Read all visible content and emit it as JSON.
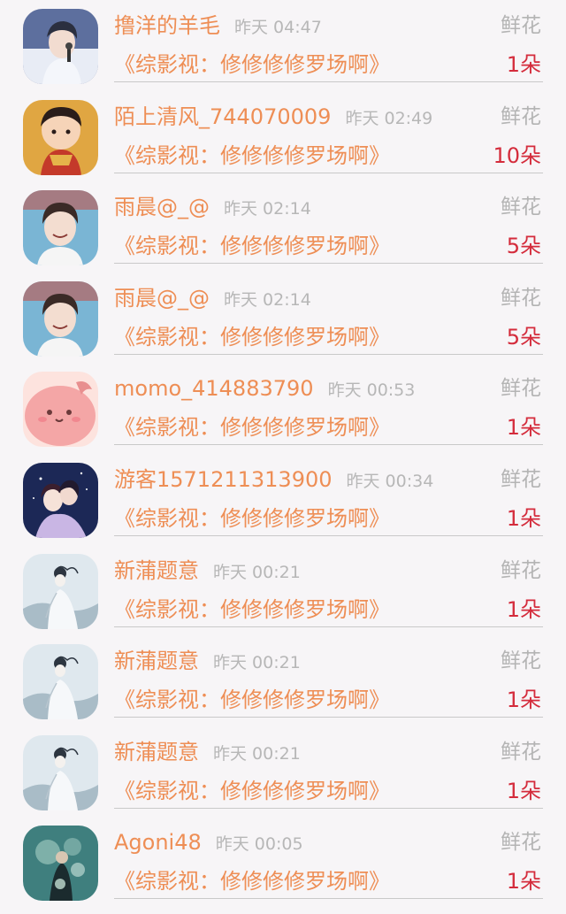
{
  "rows": [
    {
      "name": "撸洋的羊毛",
      "time": "昨天 04:47",
      "gift": "鲜花",
      "book": "《综影视：修修修修罗场啊》",
      "count": "1朵",
      "avatar_icon": "young-man-microphone-avatar",
      "colors": [
        "#5d6f9e",
        "#e8ecf5",
        "#2b2f3f"
      ]
    },
    {
      "name": "陌上清风_744070009",
      "time": "昨天 02:49",
      "gift": "鲜花",
      "book": "《综影视：修修修修罗场啊》",
      "count": "10朵",
      "avatar_icon": "cartoon-girl-red-dress-avatar",
      "colors": [
        "#e0a642",
        "#c43a2a",
        "#f6d4b8"
      ]
    },
    {
      "name": "雨晨@_@",
      "time": "昨天 02:14",
      "gift": "鲜花",
      "book": "《综影视：修修修修罗场啊》",
      "count": "5朵",
      "avatar_icon": "smiling-man-avatar",
      "colors": [
        "#7ab5d4",
        "#f3ddd0",
        "#3a2a26"
      ]
    },
    {
      "name": "雨晨@_@",
      "time": "昨天 02:14",
      "gift": "鲜花",
      "book": "《综影视：修修修修罗场啊》",
      "count": "5朵",
      "avatar_icon": "smiling-man-avatar",
      "colors": [
        "#7ab5d4",
        "#f3ddd0",
        "#3a2a26"
      ]
    },
    {
      "name": "momo_414883790",
      "time": "昨天 00:53",
      "gift": "鲜花",
      "book": "《综影视：修修修修罗场啊》",
      "count": "1朵",
      "avatar_icon": "pink-blob-cartoon-avatar",
      "colors": [
        "#f4a6a6",
        "#fde3de",
        "#6b3a3a"
      ]
    },
    {
      "name": "游客1571211313900",
      "time": "昨天 00:34",
      "gift": "鲜花",
      "book": "《综影视：修修修修罗场啊》",
      "count": "1朵",
      "avatar_icon": "anime-couple-avatar",
      "colors": [
        "#1c2856",
        "#c9b6e4",
        "#f3e3ec"
      ]
    },
    {
      "name": "新蒲题意",
      "time": "昨天 00:21",
      "gift": "鲜花",
      "book": "《综影视：修修修修罗场啊》",
      "count": "1朵",
      "avatar_icon": "ink-painting-lady-avatar",
      "colors": [
        "#dfe8ee",
        "#92a9b7",
        "#2c3540"
      ]
    },
    {
      "name": "新蒲题意",
      "time": "昨天 00:21",
      "gift": "鲜花",
      "book": "《综影视：修修修修罗场啊》",
      "count": "1朵",
      "avatar_icon": "ink-painting-lady-avatar",
      "colors": [
        "#dfe8ee",
        "#92a9b7",
        "#2c3540"
      ]
    },
    {
      "name": "新蒲题意",
      "time": "昨天 00:21",
      "gift": "鲜花",
      "book": "《综影视：修修修修罗场啊》",
      "count": "1朵",
      "avatar_icon": "ink-painting-lady-avatar",
      "colors": [
        "#dfe8ee",
        "#92a9b7",
        "#2c3540"
      ]
    },
    {
      "name": "Agoni48",
      "time": "昨天 00:05",
      "gift": "鲜花",
      "book": "《综影视：修修修修罗场啊》",
      "count": "1朵",
      "avatar_icon": "teal-bubbles-figure-avatar",
      "colors": [
        "#3f7f7e",
        "#a8d0c6",
        "#1b2b2e"
      ]
    }
  ],
  "theme": {
    "accent": "#ee8e55",
    "count_color": "#d42c3c",
    "muted": "#b7b7b7",
    "background": "#f7f5f7"
  }
}
